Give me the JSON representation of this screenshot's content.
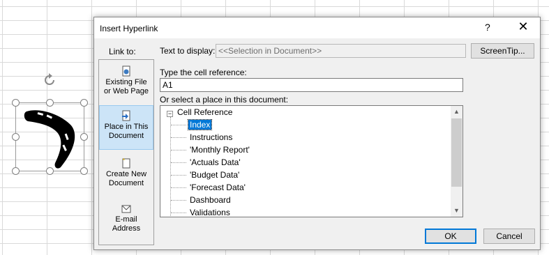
{
  "dialog": {
    "title": "Insert Hyperlink",
    "help": "?",
    "close": "✕",
    "link_to_label": "Link to:",
    "link_options": [
      {
        "line1": "Existing File",
        "line2": "or Web Page"
      },
      {
        "line1": "Place in This",
        "line2": "Document"
      },
      {
        "line1": "Create New",
        "line2": "Document"
      },
      {
        "line1": "E-mail",
        "line2": "Address"
      }
    ],
    "text_to_display_label": "Text to display:",
    "text_to_display_value": "<<Selection in Document>>",
    "screentip_button": "ScreenTip...",
    "cell_ref_label": "Type the cell reference:",
    "cell_ref_value": "A1",
    "place_label": "Or select a place in this document:",
    "tree_root": "Cell Reference",
    "tree_items": [
      "Index",
      "Instructions",
      "'Monthly Report'",
      "'Actuals Data'",
      "'Budget Data'",
      "'Forecast Data'",
      "Dashboard",
      "Validations"
    ],
    "ok_button": "OK",
    "cancel_button": "Cancel"
  }
}
